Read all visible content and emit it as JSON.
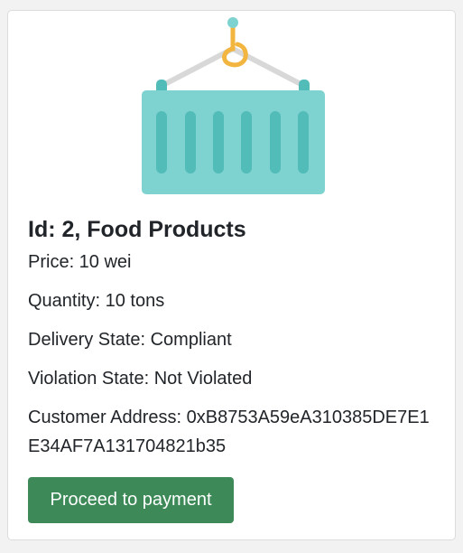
{
  "product": {
    "title": "Id: 2, Food Products",
    "price": "Price: 10 wei",
    "quantity": "Quantity: 10 tons",
    "delivery_state": "Delivery State: Compliant",
    "violation_state": "Violation State: Not Violated",
    "customer_address": "Customer Address: 0xB8753A59eA310385DE7E1E34AF7A131704821b35"
  },
  "actions": {
    "proceed_label": "Proceed to payment"
  },
  "image": {
    "icon": "cargo-container-icon",
    "colors": {
      "container": "#7ed3d1",
      "container_ribs": "#52bcb8",
      "hook": "#f2b53f",
      "cables": "#d8d8d8",
      "button": "#3d8a58"
    }
  }
}
